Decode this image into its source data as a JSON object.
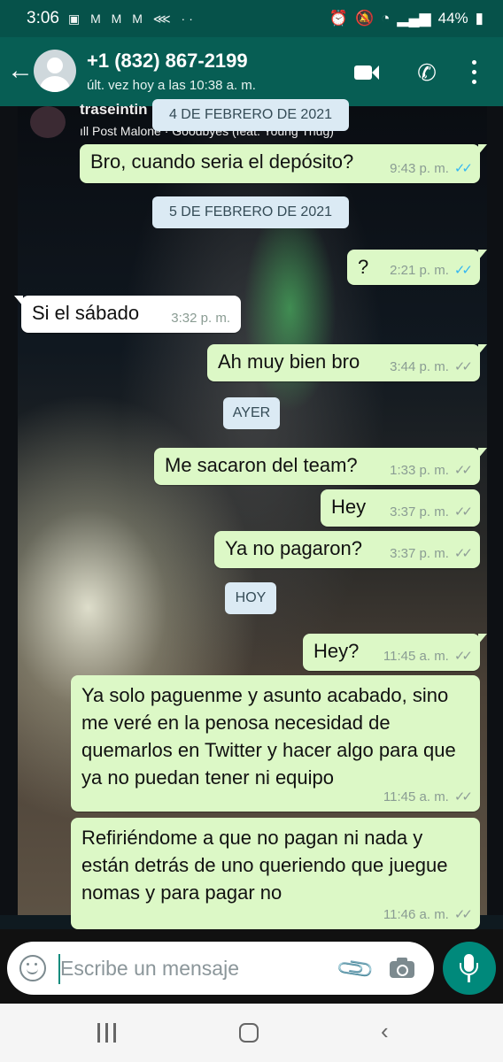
{
  "status_bar": {
    "time": "3:06",
    "battery": "44%",
    "notification_icons": [
      "message-icon",
      "gmail-icon",
      "gmail-icon",
      "gmail-icon",
      "share-icon"
    ]
  },
  "header": {
    "contact_name": "+1 (832) 867-2199",
    "last_seen": "últ. vez hoy a las 10:38 a. m."
  },
  "shared_status": {
    "name": "traseintin",
    "song": "ıll Post Malone · Goodbyes (feat. Young Thug)"
  },
  "messages": [
    {
      "type": "date",
      "text": "4 DE FEBRERO DE 2021"
    },
    {
      "type": "out",
      "text": "Bro, cuando seria el depósito?",
      "time": "9:43 p. m.",
      "status": "read"
    },
    {
      "type": "date",
      "text": "5 DE FEBRERO DE 2021"
    },
    {
      "type": "out",
      "text": "?",
      "time": "2:21 p. m.",
      "status": "read"
    },
    {
      "type": "in",
      "text": "Si el sábado",
      "time": "3:32 p. m."
    },
    {
      "type": "out",
      "text": "Ah muy bien bro",
      "time": "3:44 p. m.",
      "status": "delivered"
    },
    {
      "type": "date",
      "text": "AYER"
    },
    {
      "type": "out",
      "text": "Me sacaron del team?",
      "time": "1:33 p. m.",
      "status": "delivered"
    },
    {
      "type": "out",
      "text": "Hey",
      "time": "3:37 p. m.",
      "status": "delivered"
    },
    {
      "type": "out",
      "text": "Ya no pagaron?",
      "time": "3:37 p. m.",
      "status": "delivered"
    },
    {
      "type": "date",
      "text": "HOY"
    },
    {
      "type": "out",
      "text": "Hey?",
      "time": "11:45 a. m.",
      "status": "delivered"
    },
    {
      "type": "out",
      "text": "Ya solo paguenme y asunto acabado, sino me veré en la penosa necesidad de quemarlos en Twitter y hacer algo para que ya no puedan tener ni equipo",
      "time": "11:45 a. m.",
      "status": "delivered"
    },
    {
      "type": "out",
      "text": "Refiriéndome a que no pagan ni nada y están detrás de uno queriendo que juegue nomas y para pagar no",
      "time": "11:46 a. m.",
      "status": "delivered"
    }
  ],
  "input": {
    "placeholder": "Escribe un mensaje"
  },
  "colors": {
    "header": "#075e54",
    "status_bar": "#06524a",
    "outgoing_bubble": "#dcf8c6",
    "incoming_bubble": "#ffffff",
    "read_tick": "#34b7f1",
    "mic_button": "#00897b"
  }
}
